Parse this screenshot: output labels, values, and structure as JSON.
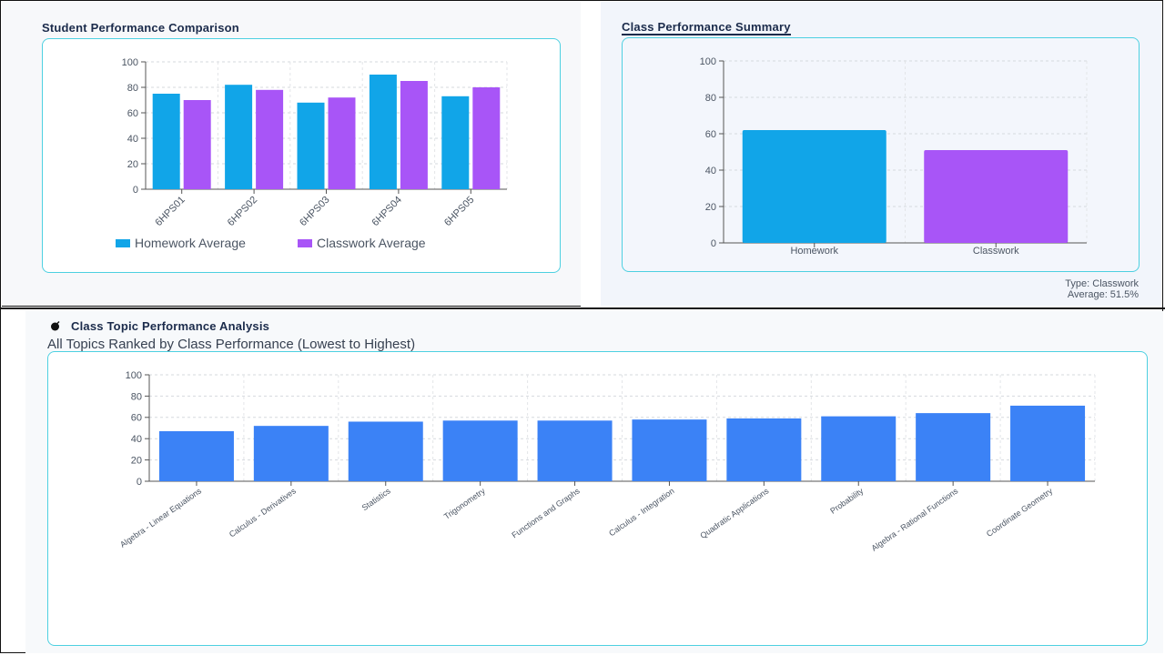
{
  "student_panel": {
    "title": "Student Performance Comparison"
  },
  "summary_panel": {
    "title": "Class Performance Summary",
    "type_line": "Type: Classwork",
    "average_line": "Average: 51.5%"
  },
  "topic_panel": {
    "title": "Class Topic Performance Analysis",
    "subtitle": "All Topics Ranked by Class Performance (Lowest to Highest)",
    "icon": "bomb-icon"
  },
  "colors": {
    "homework": "#11a5e8",
    "classwork": "#a855f7",
    "topic": "#3b82f6"
  },
  "chart_data": [
    {
      "type": "bar",
      "categories": [
        "6HPS01",
        "6HPS02",
        "6HPS03",
        "6HPS04",
        "6HPS05"
      ],
      "series": [
        {
          "name": "Homework Average",
          "values": [
            75,
            82,
            68,
            90,
            73
          ]
        },
        {
          "name": "Classwork Average",
          "values": [
            70,
            78,
            72,
            85,
            80
          ]
        }
      ],
      "yticks": [
        0,
        20,
        40,
        60,
        80,
        100
      ],
      "ylim": [
        0,
        100
      ],
      "legend": "bottom",
      "grid": true
    },
    {
      "type": "bar",
      "categories": [
        "Homework",
        "Classwork"
      ],
      "values": [
        62,
        51
      ],
      "yticks": [
        0,
        20,
        40,
        60,
        80,
        100
      ],
      "ylim": [
        0,
        100
      ],
      "grid": true
    },
    {
      "type": "bar",
      "categories": [
        "Algebra - Linear Equations",
        "Calculus - Derivatives",
        "Statistics",
        "Trigonometry",
        "Functions and Graphs",
        "Calculus - Integration",
        "Quadratic Applications",
        "Probability",
        "Algebra - Rational Functions",
        "Coordinate Geometry"
      ],
      "values": [
        47,
        52,
        56,
        57,
        57,
        58,
        59,
        61,
        64,
        71
      ],
      "yticks": [
        0,
        20,
        40,
        60,
        80,
        100
      ],
      "ylim": [
        0,
        100
      ],
      "grid": true
    }
  ]
}
